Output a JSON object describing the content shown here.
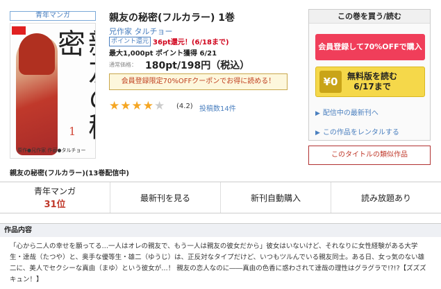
{
  "genre_badge": "青年マンガ",
  "cover": {
    "title_glyphs": "親友の秘密",
    "volume": "1",
    "credit": "原作●兄作家 作画●タルチョー"
  },
  "cover_caption": "親友の秘密(フルカラー)(13巻配信中)",
  "title": "親友の秘密(フルカラー) 1巻",
  "author": {
    "label": "兄作家",
    "sep": " ",
    "artist": "タルチョー"
  },
  "point": {
    "badge": "ポイント還元",
    "text": "36pt還元！(6/18まで)"
  },
  "max_points": "最大1,000pt ポイント獲得 6/21",
  "price": {
    "label": "通常価格：",
    "value": "180pt/198円（税込）"
  },
  "coupon": "会員登録限定70%OFFクーポンでお得に読める！",
  "rating": {
    "score": 4.2,
    "text": "(4.2)",
    "reviews": "投稿数14件"
  },
  "buybox": {
    "heading": "この巻を買う/読む",
    "register_btn": "会員登録して70%OFFで購入",
    "free_icon": "¥0",
    "free_line1": "無料版を読む",
    "free_line2": "6/17まで",
    "link1": "配信中の最新刊へ",
    "link2": "この作品をレンタルする"
  },
  "similar": "このタイトルの類似作品",
  "stats": [
    {
      "label": "青年マンガ",
      "rank": "31位"
    },
    {
      "label": "最新刊を見る"
    },
    {
      "label": "新刊自動購入"
    },
    {
      "label": "読み放題あり"
    }
  ],
  "desc_heading": "作品内容",
  "description": "「心から二人の幸せを願ってる…一人はオレの親友で、もう一人は親友の彼女だから」彼女はいないけど、それなりに女性経験がある大学生・達哉（たつや）と、奥手な優等生・雄二（ゆうじ）は、正反対なタイプだけど、いつもツルんでいる親友同士。ある日、女っ気のない雄二に、美人でセクシーな真由（まゆ）という彼女が…！ 親友の恋人なのに――真由の色香に惑わされて達哉の理性はグラグラで!?!?【ズズズキュン！】",
  "colors": {
    "accent_blue": "#4a7fbf",
    "register_red": "#f03e5a",
    "free_yellow": "#f5d84a",
    "star": "#f5a623"
  }
}
